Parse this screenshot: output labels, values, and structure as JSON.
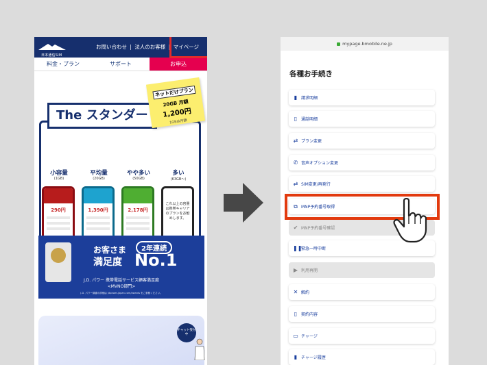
{
  "left_phone": {
    "logo_text": "日本通信SIM",
    "top_links": [
      "お問い合わせ",
      "|",
      "法人のお客様",
      "|",
      "マイページ"
    ],
    "nav_tabs": [
      "料金・プラン",
      "サポート",
      "お申込"
    ],
    "sticky_note": {
      "tag": "ネットだけプラン",
      "price_gb": "20GB",
      "price_unit": "月額",
      "price_value": "1,200円",
      "sub": "1GBは月額"
    },
    "banner_title": "The スタンダード",
    "plans": [
      {
        "name": "小容量",
        "gb": "(1GB)",
        "price": "290円"
      },
      {
        "name": "平均量",
        "gb": "(20GB)",
        "price": "1,390円"
      },
      {
        "name": "やや多い",
        "gb": "(50GB)",
        "price": "2,178円"
      },
      {
        "name": "多い",
        "gb": "(63GB〜)",
        "price": "これ以上の容量は携帯キャリアのプランをお勧めします。"
      }
    ],
    "award": {
      "line1": "お客さま",
      "tag": "2年連続",
      "line2": "満足度",
      "no1": "No.1",
      "caption1": "J.D. パワー 携帯電話サービス顧客満足度",
      "caption2": "<MVNO部門>",
      "caption3": "J.D. パワー調査の詳細は jdpower-japan.com/awards をご参照ください。"
    },
    "chat_label": "チャット受付中"
  },
  "right_phone": {
    "url": "mypage.bmobile.ne.jp",
    "title": "各種お手続き",
    "menu": [
      {
        "label": "請求明細",
        "icon": "document-icon",
        "disabled": false
      },
      {
        "label": "通話明細",
        "icon": "document-outline-icon",
        "disabled": false
      },
      {
        "label": "プラン変更",
        "icon": "swap-icon",
        "disabled": false
      },
      {
        "label": "音声オプション変更",
        "icon": "phone-icon",
        "disabled": false
      },
      {
        "label": "SIM変更/再発行",
        "icon": "swap-icon",
        "disabled": false
      },
      {
        "label": "MNP予約番号取得",
        "icon": "mnp-icon",
        "disabled": false
      },
      {
        "label": "MNP予約番号確認",
        "icon": "check-icon",
        "disabled": true
      },
      {
        "label": "緊急一時中断",
        "icon": "pause-icon",
        "disabled": false
      },
      {
        "label": "利用再開",
        "icon": "play-icon",
        "disabled": true
      },
      {
        "label": "解約",
        "icon": "close-icon",
        "disabled": false
      },
      {
        "label": "契約内容",
        "icon": "document-outline-icon",
        "disabled": false
      },
      {
        "label": "チャージ",
        "icon": "battery-icon",
        "disabled": false
      },
      {
        "label": "チャージ履歴",
        "icon": "document-icon",
        "disabled": false
      }
    ]
  },
  "colors": {
    "brand_navy": "#162f6d",
    "apply_pink": "#e5004f",
    "highlight_red": "#e23a0e",
    "link_blue": "#1a3f9e"
  }
}
